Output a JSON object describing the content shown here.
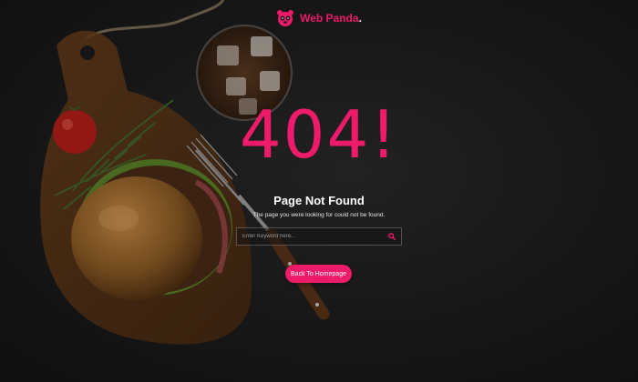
{
  "brand": {
    "name": "Web Panda",
    "dot": ".",
    "accent_color": "#ee1a6a",
    "icon": "panda-icon"
  },
  "error": {
    "code": "404!",
    "title": "Page Not Found",
    "message": "The page you were looking for could not be found."
  },
  "search": {
    "placeholder": "Enter Keyword here...",
    "value": "",
    "icon": "search-icon"
  },
  "cta": {
    "label": "Back To Homepage"
  },
  "background": {
    "description_icons": [
      "burger-image",
      "cutting-board-image",
      "drink-glass-image",
      "fork-image",
      "tomato-image"
    ]
  }
}
